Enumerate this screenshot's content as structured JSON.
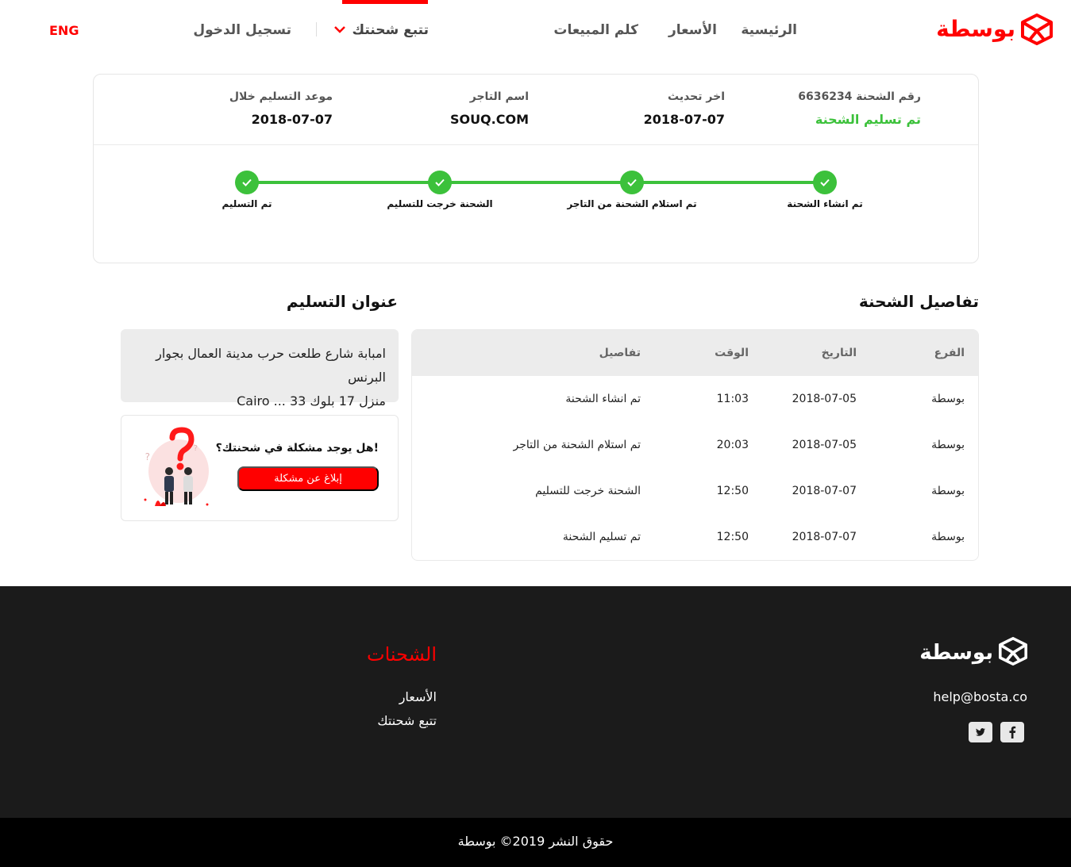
{
  "brand": {
    "name": "بوسطة",
    "color": "#ff0000"
  },
  "nav": {
    "home": "الرئيسية",
    "prices": "الأسعار",
    "sales": "كلم المبيعات",
    "track": "تتبع شحنتك",
    "login": "تسجيل الدخول",
    "lang": "ENG"
  },
  "shipment": {
    "number_label": "رقم الشحنة 6636234",
    "status": "تم تسليم الشحنة",
    "last_update_label": "اخر تحديث",
    "last_update_value": "2018-07-07",
    "merchant_label": "اسم التاجر",
    "merchant_value": "SOUQ.COM",
    "delivery_label": "موعد التسليم خلال",
    "delivery_value": "2018-07-07",
    "status_color": "#3cc13b"
  },
  "steps": [
    {
      "label": "تم انشاء الشحنة",
      "done": true
    },
    {
      "label": "تم استلام الشحنة من التاجر",
      "done": true
    },
    {
      "label": "الشحنة خرجت للتسليم",
      "done": true
    },
    {
      "label": "تم التسليم",
      "done": true
    }
  ],
  "details": {
    "title": "تفاصيل الشحنة",
    "headers": {
      "branch": "الفرع",
      "date": "التاريخ",
      "time": "الوقت",
      "detail": "تفاصيل"
    },
    "rows": [
      {
        "branch": "بوسطة",
        "date": "2018-07-05",
        "time": "11:03",
        "detail": "تم انشاء الشحنة"
      },
      {
        "branch": "بوسطة",
        "date": "2018-07-05",
        "time": "20:03",
        "detail": "تم استلام الشحنة من التاجر"
      },
      {
        "branch": "بوسطة",
        "date": "2018-07-07",
        "time": "12:50",
        "detail": "الشحنة خرجت للتسليم"
      },
      {
        "branch": "بوسطة",
        "date": "2018-07-07",
        "time": "12:50",
        "detail": "تم تسليم الشحنة"
      }
    ]
  },
  "address": {
    "title": "عنوان التسليم",
    "line1": "امبابة شارع طلعت حرب مدينة العمال بجوار البرنس",
    "line2": "منزل 17 بلوك 33 ... Cairo"
  },
  "problem": {
    "question": "!هل يوجد مشكلة في شحنتك؟",
    "button": "إبلاغ عن مشكلة",
    "illustration": "question-mark-people-illustration"
  },
  "footer": {
    "email": "help@bosta.co",
    "social": [
      "facebook-icon",
      "twitter-icon"
    ],
    "heading": "الشحنات",
    "links": [
      "الأسعار",
      "تتبع شحنتك"
    ],
    "copyright": "حقوق النشر 2019© بوسطة"
  }
}
